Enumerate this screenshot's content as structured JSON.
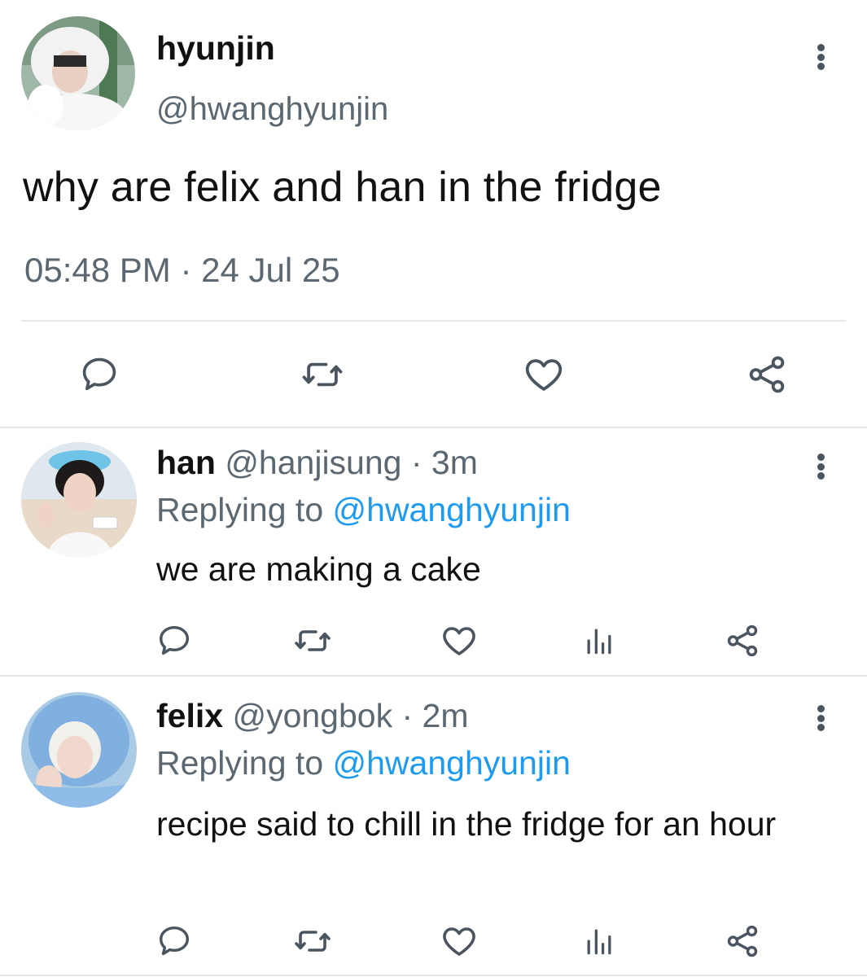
{
  "main_tweet": {
    "name": "hyunjin",
    "handle": "@hwanghyunjin",
    "text": "why are felix and han in the fridge",
    "timestamp": "05:48 PM · 24 Jul 25",
    "actions": [
      "reply-icon",
      "retweet-icon",
      "like-icon",
      "share-icon"
    ]
  },
  "replies": [
    {
      "name": "han",
      "handle": "@hanjisung",
      "sep": " · ",
      "age": "3m",
      "replying_prefix": "Replying to ",
      "replying_to": "@hwanghyunjin",
      "text": "we are making a cake",
      "actions": [
        "reply-icon",
        "retweet-icon",
        "like-icon",
        "views-icon",
        "share-icon"
      ]
    },
    {
      "name": "felix",
      "handle": "@yongbok",
      "sep": " · ",
      "age": "2m",
      "replying_prefix": "Replying to ",
      "replying_to": "@hwanghyunjin",
      "text": "recipe said to chill in the fridge for an hour",
      "actions": [
        "reply-icon",
        "retweet-icon",
        "like-icon",
        "views-icon",
        "share-icon"
      ]
    }
  ],
  "colors": {
    "text": "#111111",
    "secondary": "#5b6872",
    "link": "#1d9bf0",
    "icon": "#4a5560",
    "divider": "#e3e7eb"
  }
}
